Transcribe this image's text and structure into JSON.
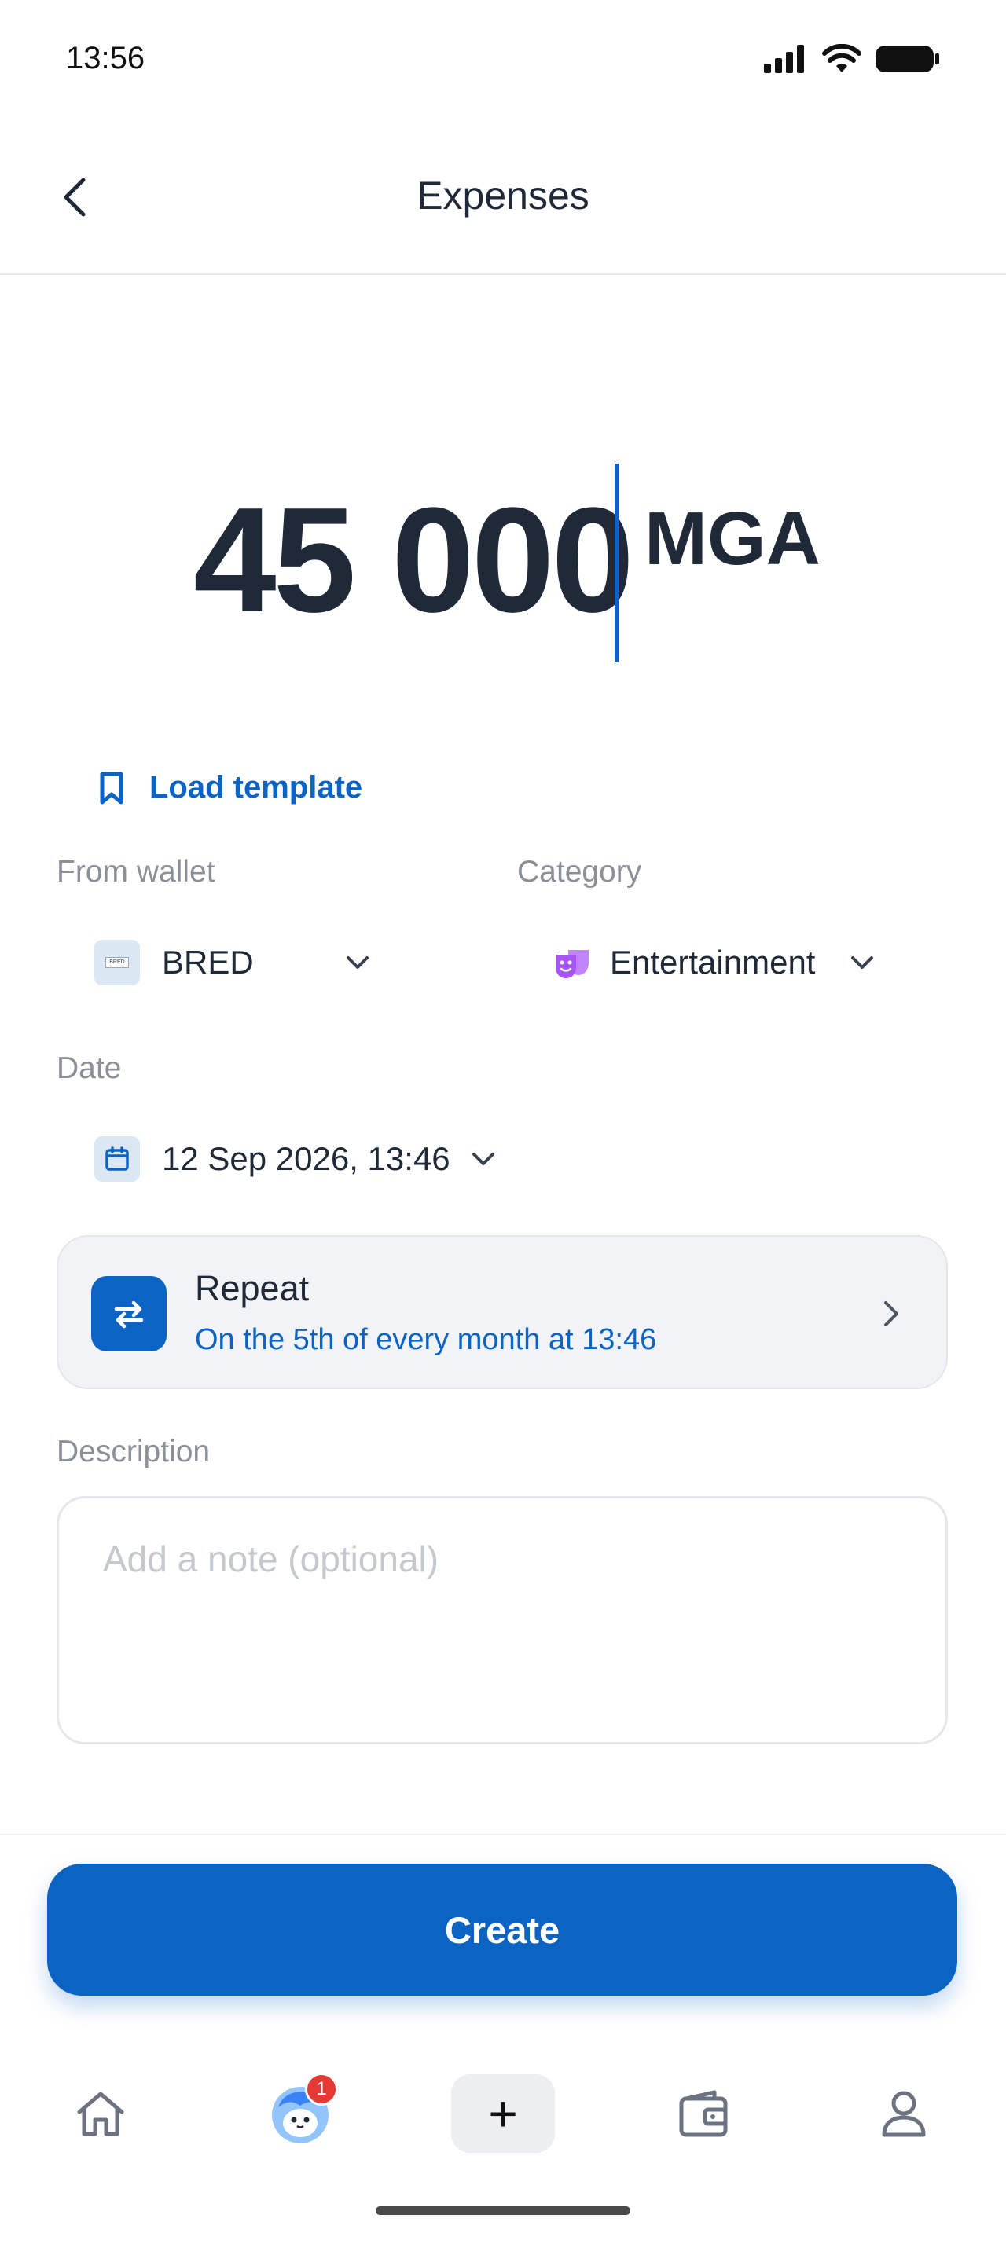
{
  "status_bar": {
    "time": "13:56"
  },
  "header": {
    "title": "Expenses"
  },
  "amount": {
    "value": "45 000",
    "currency": "MGA"
  },
  "load_template": {
    "label": "Load template"
  },
  "from_wallet": {
    "label": "From wallet",
    "value": "BRED"
  },
  "category": {
    "label": "Category",
    "value": "Entertainment"
  },
  "date": {
    "label": "Date",
    "value": "12 Sep 2026, 13:46"
  },
  "repeat": {
    "title": "Repeat",
    "subtitle": "On the 5th of every month at 13:46"
  },
  "description": {
    "label": "Description",
    "placeholder": "Add a note (optional)",
    "value": ""
  },
  "create_button": {
    "label": "Create"
  },
  "tabbar": {
    "items": [
      {
        "icon": "home-icon"
      },
      {
        "icon": "avatar-icon",
        "badge": "1"
      },
      {
        "icon": "plus-icon",
        "label": "+"
      },
      {
        "icon": "wallet-icon"
      },
      {
        "icon": "profile-icon"
      }
    ]
  },
  "colors": {
    "accent": "#0b63c4",
    "badge": "#e53935",
    "category_icon": "#a855f7"
  }
}
